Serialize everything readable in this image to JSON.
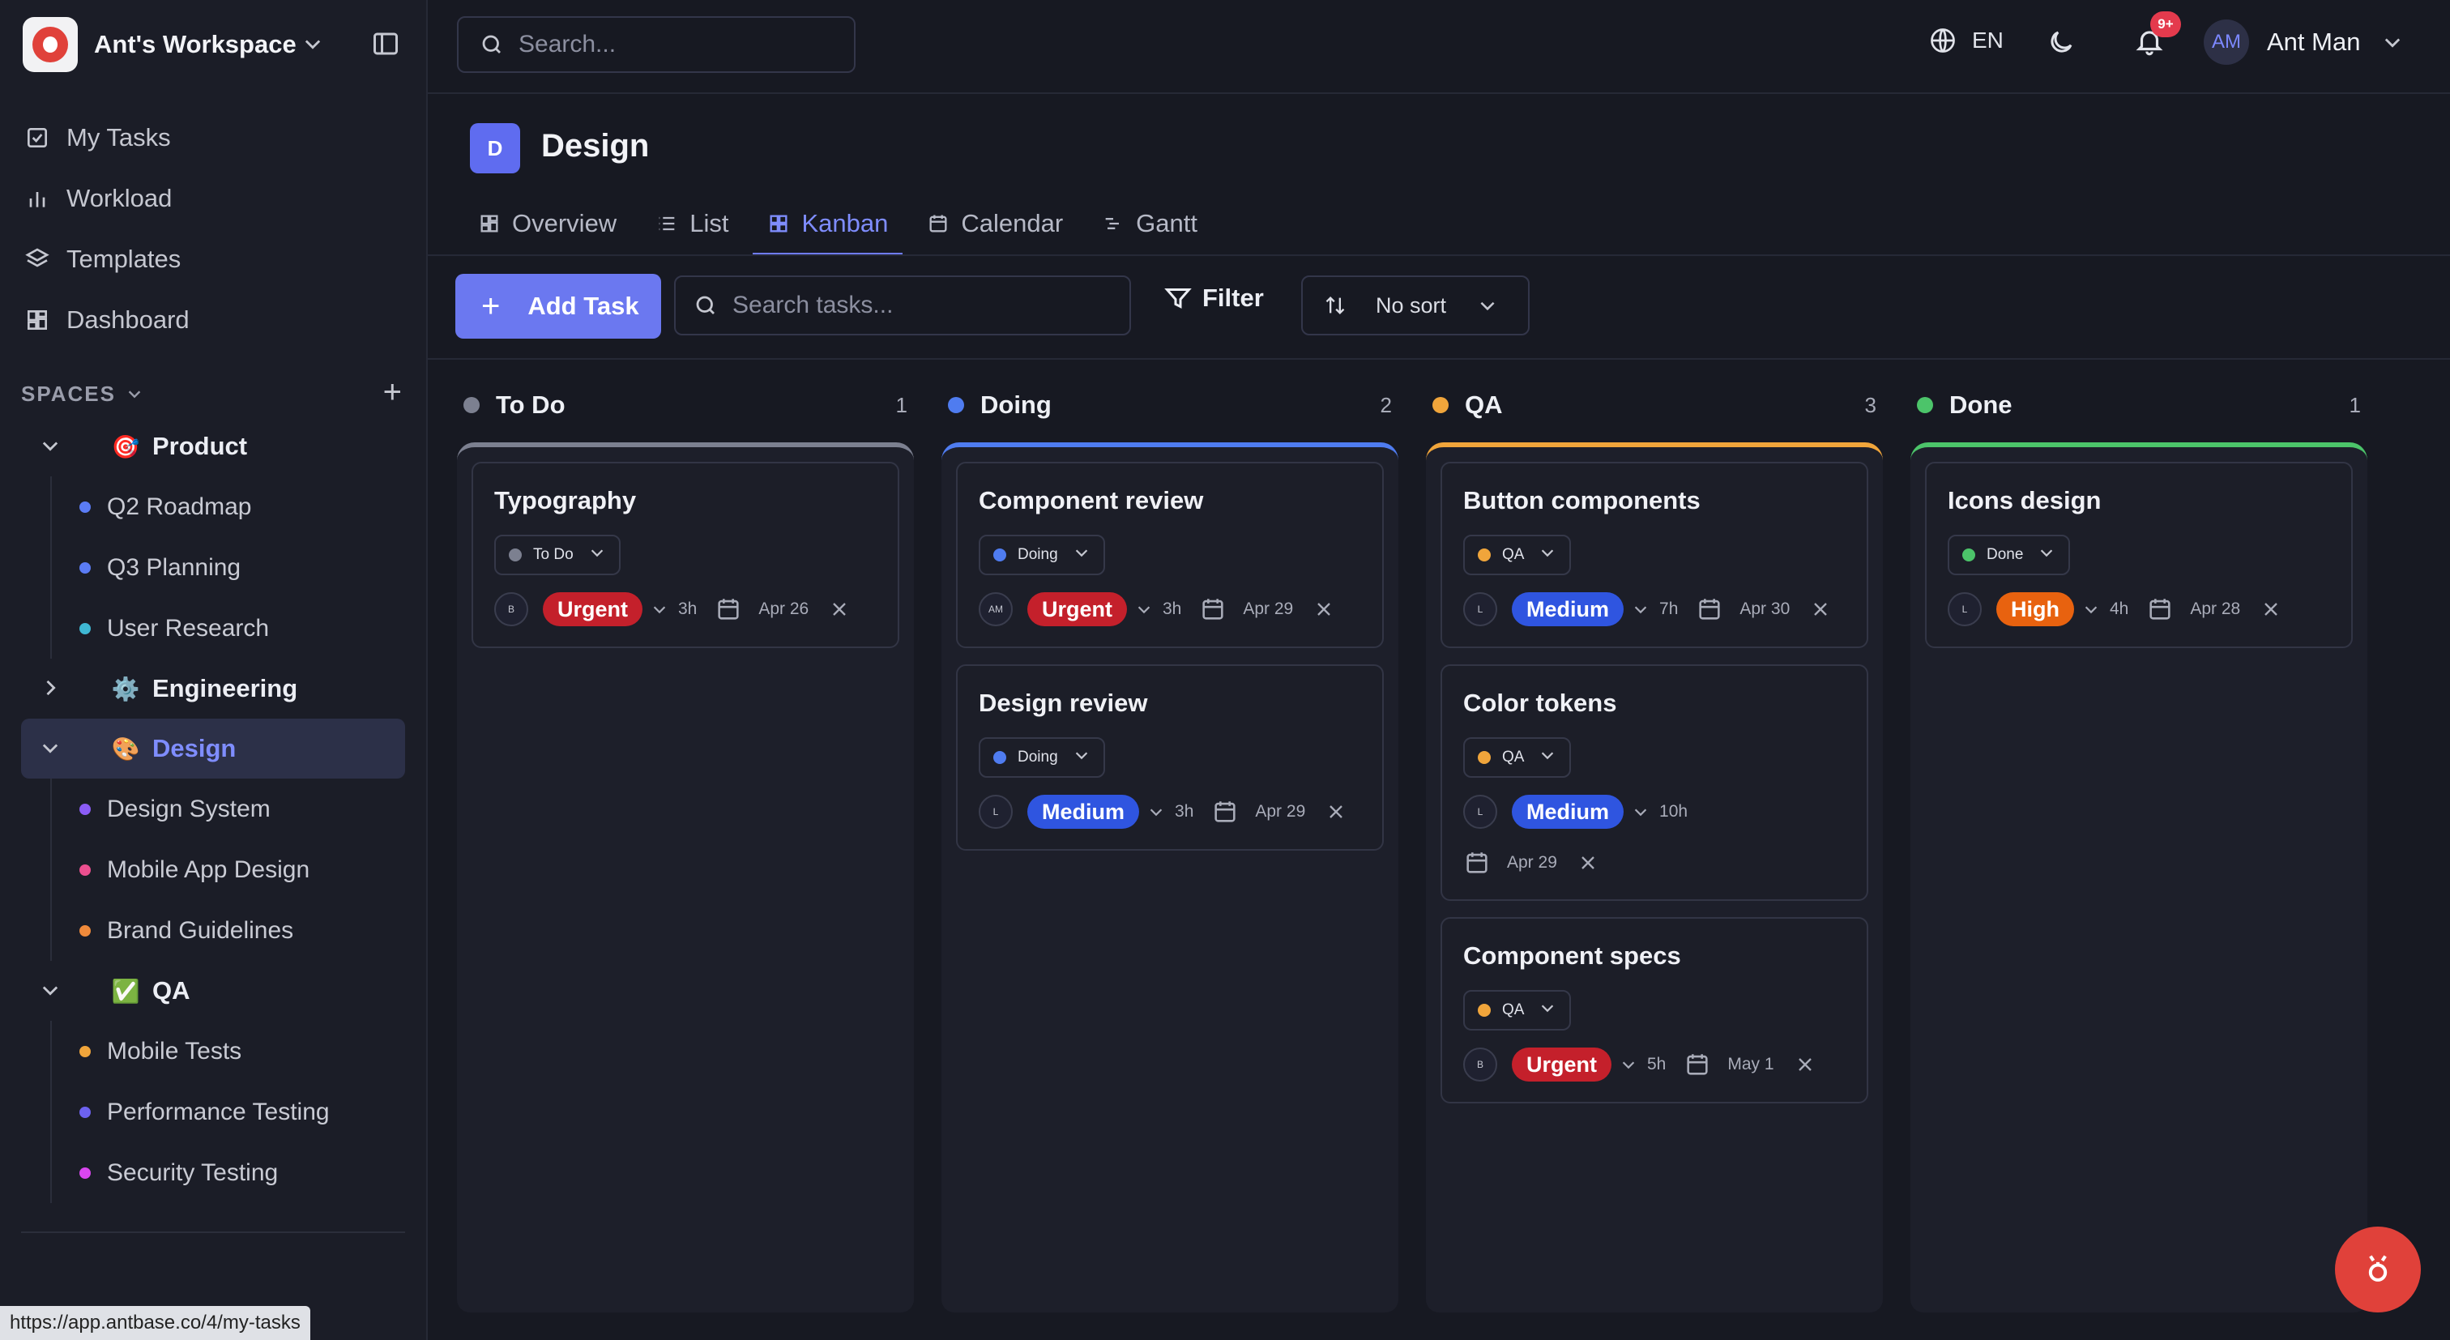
{
  "workspace": {
    "name": "Ant's Workspace"
  },
  "nav": [
    {
      "label": "My Tasks",
      "icon": "checkbox-icon"
    },
    {
      "label": "Workload",
      "icon": "bar-chart-icon"
    },
    {
      "label": "Templates",
      "icon": "layers-icon"
    },
    {
      "label": "Dashboard",
      "icon": "dashboard-icon"
    }
  ],
  "spaces_label": "SPACES",
  "spaces": [
    {
      "name": "Product",
      "emoji": "🎯",
      "expanded": true,
      "items": [
        {
          "label": "Q2 Roadmap",
          "color": "#5b7cf5"
        },
        {
          "label": "Q3 Planning",
          "color": "#5b7cf5"
        },
        {
          "label": "User Research",
          "color": "#3fb8d4"
        }
      ]
    },
    {
      "name": "Engineering",
      "emoji": "⚙️",
      "expanded": false,
      "items": []
    },
    {
      "name": "Design",
      "emoji": "🎨",
      "expanded": true,
      "active": true,
      "items": [
        {
          "label": "Design System",
          "color": "#8b5cf6"
        },
        {
          "label": "Mobile App Design",
          "color": "#ec4f8f"
        },
        {
          "label": "Brand Guidelines",
          "color": "#f08a3b"
        }
      ]
    },
    {
      "name": "QA",
      "emoji": "✅",
      "expanded": true,
      "items": [
        {
          "label": "Mobile Tests",
          "color": "#f0a53b"
        },
        {
          "label": "Performance Testing",
          "color": "#6d62f0"
        },
        {
          "label": "Security Testing",
          "color": "#d946ef"
        }
      ]
    }
  ],
  "status_url": "https://app.antbase.co/4/my-tasks",
  "topbar": {
    "search_placeholder": "Search...",
    "lang": "EN",
    "notif_badge": "9+",
    "user_initials": "AM",
    "user_name": "Ant Man"
  },
  "project": {
    "initial": "D",
    "title": "Design"
  },
  "tabs": [
    {
      "label": "Overview",
      "icon": "grid-icon"
    },
    {
      "label": "List",
      "icon": "list-icon"
    },
    {
      "label": "Kanban",
      "icon": "kanban-icon",
      "active": true
    },
    {
      "label": "Calendar",
      "icon": "calendar-icon"
    },
    {
      "label": "Gantt",
      "icon": "gantt-icon"
    }
  ],
  "toolbar": {
    "add_task": "Add Task",
    "search_placeholder": "Search tasks...",
    "filter": "Filter",
    "sort": "No sort"
  },
  "columns": [
    {
      "name": "To Do",
      "count": "1",
      "color": "#7c8090",
      "cards": [
        {
          "title": "Typography",
          "status": "To Do",
          "assignee": "B",
          "priority": "Urgent",
          "estimate": "3h",
          "date": "Apr 26"
        }
      ]
    },
    {
      "name": "Doing",
      "count": "2",
      "color": "#4f7cf0",
      "cards": [
        {
          "title": "Component review",
          "status": "Doing",
          "assignee": "AM",
          "priority": "Urgent",
          "estimate": "3h",
          "date": "Apr 29"
        },
        {
          "title": "Design review",
          "status": "Doing",
          "assignee": "L",
          "priority": "Medium",
          "estimate": "3h",
          "date": "Apr 29"
        }
      ]
    },
    {
      "name": "QA",
      "count": "3",
      "color": "#f0a53b",
      "cards": [
        {
          "title": "Button components",
          "status": "QA",
          "assignee": "L",
          "priority": "Medium",
          "estimate": "7h",
          "date": "Apr 30"
        },
        {
          "title": "Color tokens",
          "status": "QA",
          "assignee": "L",
          "priority": "Medium",
          "estimate": "10h",
          "date": "Apr 29",
          "wrap": true
        },
        {
          "title": "Component specs",
          "status": "QA",
          "assignee": "B",
          "priority": "Urgent",
          "estimate": "5h",
          "date": "May 1"
        }
      ]
    },
    {
      "name": "Done",
      "count": "1",
      "color": "#4cc46a",
      "cards": [
        {
          "title": "Icons design",
          "status": "Done",
          "assignee": "L",
          "priority": "High",
          "estimate": "4h",
          "date": "Apr 28"
        }
      ]
    }
  ],
  "priority_colors": {
    "Urgent": "#c4202b",
    "Medium": "#2f55e0",
    "High": "#e8620f"
  }
}
